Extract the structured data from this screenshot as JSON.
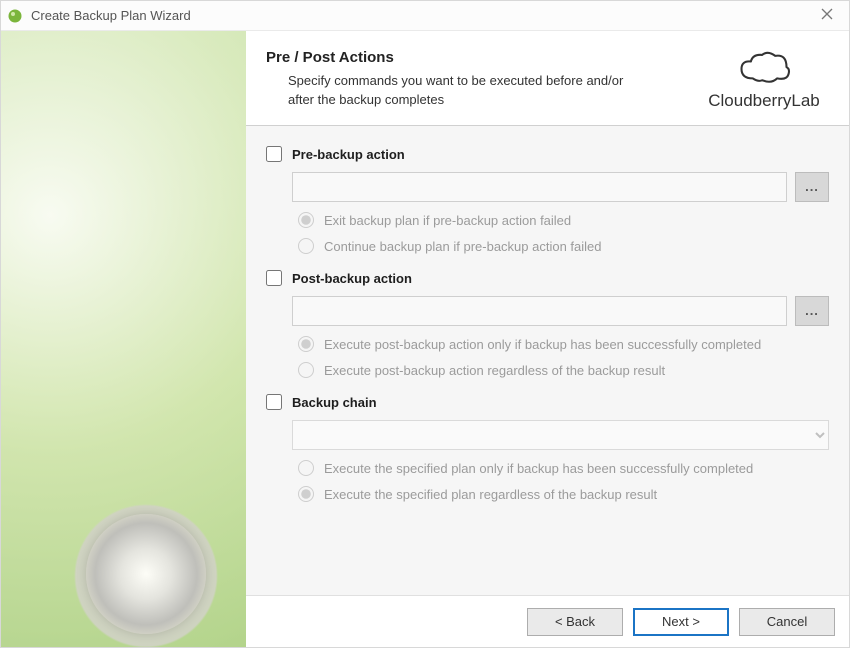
{
  "window": {
    "title": "Create Backup Plan Wizard"
  },
  "brand": {
    "name": "CloudberryLab"
  },
  "header": {
    "title": "Pre / Post Actions",
    "description": "Specify commands you want to be executed before and/or after the backup completes"
  },
  "pre": {
    "label": "Pre-backup action",
    "checked": false,
    "cmd_value": "",
    "browse_label": "...",
    "radio_exit": "Exit backup plan if pre-backup action failed",
    "radio_continue": "Continue backup plan if pre-backup action failed",
    "radio_selected": "exit"
  },
  "post": {
    "label": "Post-backup action",
    "checked": false,
    "cmd_value": "",
    "browse_label": "...",
    "radio_only_success": "Execute post-backup action only if backup has been successfully completed",
    "radio_regardless": "Execute post-backup action regardless of the backup result",
    "radio_selected": "only_success"
  },
  "chain": {
    "label": "Backup chain",
    "checked": false,
    "path_value": "",
    "radio_only_success": "Execute the specified plan only if backup has been successfully completed",
    "radio_regardless": "Execute the specified plan regardless of the backup result",
    "radio_selected": "regardless"
  },
  "footer": {
    "back": "< Back",
    "next": "Next >",
    "cancel": "Cancel"
  }
}
